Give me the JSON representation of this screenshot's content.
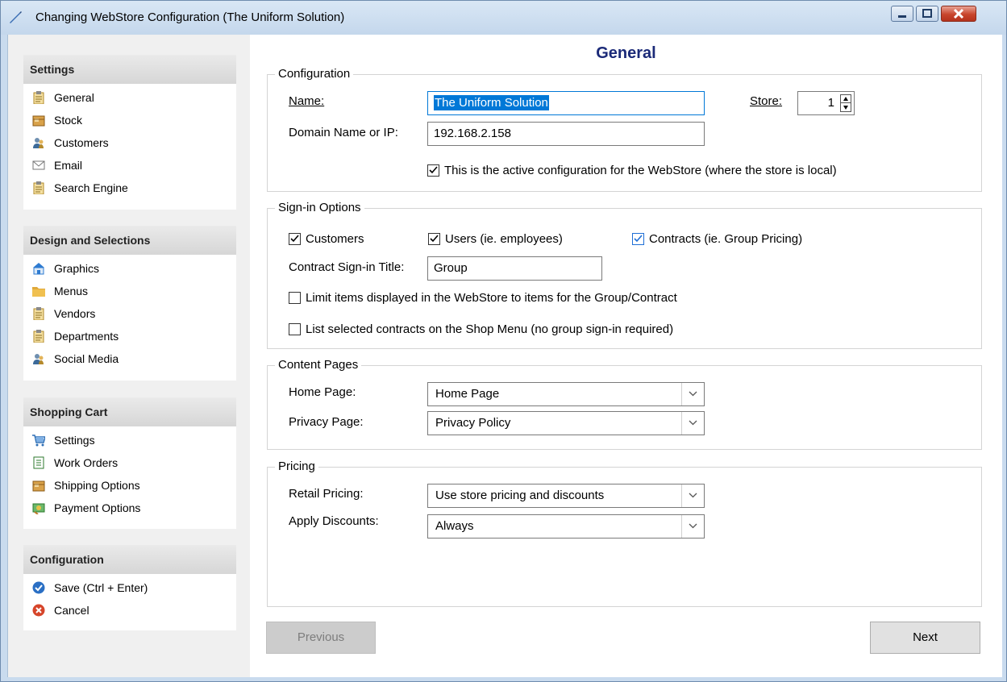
{
  "window": {
    "title": "Changing WebStore Configuration  (The Uniform Solution)"
  },
  "sidebar": {
    "sections": [
      {
        "title": "Settings",
        "items": [
          {
            "label": "General",
            "icon": "clipboard-icon"
          },
          {
            "label": "Stock",
            "icon": "box-icon"
          },
          {
            "label": "Customers",
            "icon": "users-icon"
          },
          {
            "label": "Email",
            "icon": "envelope-icon"
          },
          {
            "label": "Search Engine",
            "icon": "clipboard-icon"
          }
        ]
      },
      {
        "title": "Design and Selections",
        "items": [
          {
            "label": "Graphics",
            "icon": "store-icon"
          },
          {
            "label": "Menus",
            "icon": "folder-icon"
          },
          {
            "label": "Vendors",
            "icon": "clipboard-icon"
          },
          {
            "label": "Departments",
            "icon": "clipboard-icon"
          },
          {
            "label": "Social Media",
            "icon": "users-icon"
          }
        ]
      },
      {
        "title": "Shopping Cart",
        "items": [
          {
            "label": "Settings",
            "icon": "cart-icon"
          },
          {
            "label": "Work Orders",
            "icon": "document-icon"
          },
          {
            "label": "Shipping Options",
            "icon": "box-icon"
          },
          {
            "label": "Payment Options",
            "icon": "payment-icon"
          }
        ]
      },
      {
        "title": "Configuration",
        "items": [
          {
            "label": "Save (Ctrl + Enter)",
            "icon": "check-circle-icon"
          },
          {
            "label": "Cancel",
            "icon": "cancel-circle-icon"
          }
        ]
      }
    ]
  },
  "main": {
    "title": "General",
    "configuration": {
      "legend": "Configuration",
      "name_label": "Name:",
      "name_value": "The Uniform Solution",
      "domain_label": "Domain Name or IP:",
      "domain_value": "192.168.2.158",
      "store_label": "Store:",
      "store_value": "1",
      "active_checkbox": "This is the active configuration for the WebStore (where the store is local)",
      "active_checked": true
    },
    "signin": {
      "legend": "Sign-in Options",
      "customers": "Customers",
      "customers_checked": true,
      "users": "Users (ie. employees)",
      "users_checked": true,
      "contracts": "Contracts (ie. Group Pricing)",
      "contracts_checked": true,
      "contract_title_label": "Contract Sign-in Title:",
      "contract_title_value": "Group",
      "limit_items": "Limit items displayed in the WebStore to items for the Group/Contract",
      "limit_items_checked": false,
      "list_contracts": "List selected contracts on the Shop Menu (no group sign-in required)",
      "list_contracts_checked": false
    },
    "content_pages": {
      "legend": "Content Pages",
      "home_label": "Home Page:",
      "home_value": "Home Page",
      "privacy_label": "Privacy Page:",
      "privacy_value": "Privacy Policy"
    },
    "pricing": {
      "legend": "Pricing",
      "retail_label": "Retail Pricing:",
      "retail_value": "Use store pricing and discounts",
      "discounts_label": "Apply Discounts:",
      "discounts_value": "Always"
    },
    "buttons": {
      "previous": "Previous",
      "next": "Next"
    }
  }
}
